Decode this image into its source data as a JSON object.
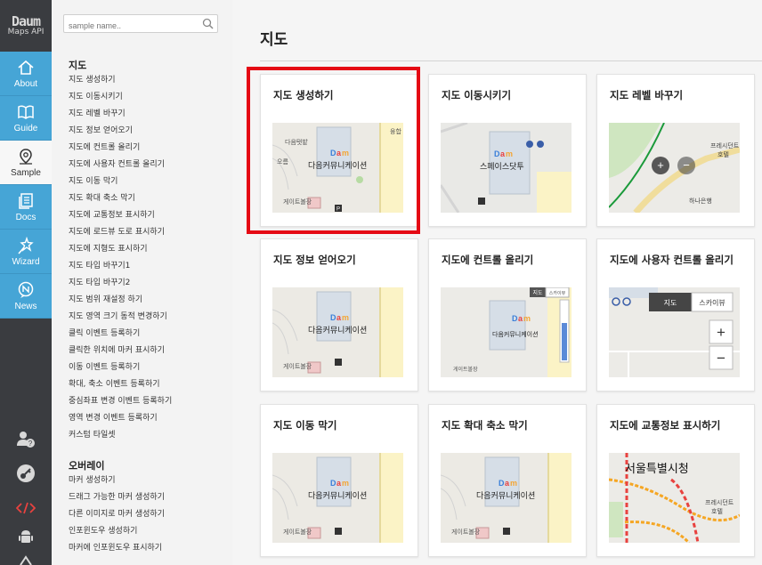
{
  "brand": {
    "mark": "Daum",
    "subtitle": "Maps API"
  },
  "rail": {
    "items": [
      {
        "label": "About",
        "icon": "home-icon",
        "active": false
      },
      {
        "label": "Guide",
        "icon": "book-icon",
        "active": false
      },
      {
        "label": "Sample",
        "icon": "map-pin-icon",
        "active": true
      },
      {
        "label": "Docs",
        "icon": "document-icon",
        "active": false
      },
      {
        "label": "Wizard",
        "icon": "wand-icon",
        "active": false
      },
      {
        "label": "News",
        "icon": "news-icon",
        "active": false
      }
    ],
    "bottom_icons": [
      "user-help-icon",
      "key-icon",
      "code-icon",
      "android-icon"
    ]
  },
  "sidebar": {
    "search_placeholder": "sample name..",
    "group1_title": "지도",
    "group1_items": [
      "지도 생성하기",
      "지도 이동시키기",
      "지도 레벨 바꾸기",
      "지도 정보 얻어오기",
      "지도에 컨트롤 올리기",
      "지도에 사용자 컨트롤 올리기",
      "지도 이동 막기",
      "지도 확대 축소 막기",
      "지도에 교통정보 표시하기",
      "지도에 로드뷰 도로 표시하기",
      "지도에 지형도 표시하기",
      "지도 타입 바꾸기1",
      "지도 타입 바꾸기2",
      "지도 범위 재설정 하기",
      "지도 영역 크기 동적 변경하기",
      "클릭 이벤트 등록하기",
      "클릭한 위치에 마커 표시하기",
      "이동 이벤트 등록하기",
      "확대, 축소 이벤트 등록하기",
      "중심좌표 변경 이벤트 등록하기",
      "영역 변경 이벤트 등록하기",
      "커스텀 타일셋"
    ],
    "group2_title": "오버레이",
    "group2_items": [
      "마커 생성하기",
      "드래그 가능한 마커 생성하기",
      "다른 이미지로 마커 생성하기",
      "인포윈도우 생성하기",
      "마커에 인포윈도우 표시하기"
    ]
  },
  "main": {
    "title": "지도",
    "cards": [
      {
        "title": "지도 생성하기",
        "thumb": "daum"
      },
      {
        "title": "지도 이동시키기",
        "thumb": "space"
      },
      {
        "title": "지도 레벨 바꾸기",
        "thumb": "level"
      },
      {
        "title": "지도 정보 얻어오기",
        "thumb": "daum"
      },
      {
        "title": "지도에 컨트롤 올리기",
        "thumb": "control"
      },
      {
        "title": "지도에 사용자 컨트롤 올리기",
        "thumb": "usercontrol"
      },
      {
        "title": "지도 이동 막기",
        "thumb": "daum"
      },
      {
        "title": "지도 확대 축소 막기",
        "thumb": "daum"
      },
      {
        "title": "지도에 교통정보 표시하기",
        "thumb": "traffic"
      }
    ]
  },
  "thumb_text": {
    "daum_cafe": "다음탯밭",
    "daum_company": "다음커뮤니케이션",
    "daum_gate": "게이트볼장",
    "daum_oreum": "오름",
    "daum_yung": "융합",
    "space_dot": "스페이스닷투",
    "level_pres": "프레시던트",
    "level_hotel": "호텔",
    "level_bank": "하나은행",
    "ctrl_map": "지도",
    "ctrl_sky": "스카이뷰",
    "usr_map": "지도",
    "usr_sky": "스카이뷰",
    "traffic_city": "서울특별시청",
    "traffic_pres": "프레시던트",
    "traffic_hotel": "호텔"
  },
  "colors": {
    "rail_bg": "#3a3c40",
    "rail_accent": "#46a5d6",
    "highlight": "#e50914",
    "code_icon": "#e8423f"
  }
}
